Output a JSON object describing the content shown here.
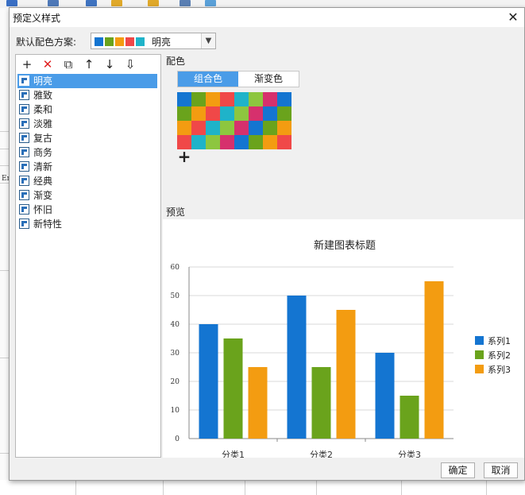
{
  "dialog": {
    "title": "预定义样式",
    "scheme_label": "默认配色方案:",
    "scheme_value": "明亮",
    "scheme_swatches": [
      "#1475d1",
      "#6aa31c",
      "#f39c11",
      "#f04848",
      "#1fb3c9"
    ],
    "ok_label": "确定",
    "cancel_label": "取消"
  },
  "toolbar": {
    "icons": [
      "add-icon",
      "delete-icon",
      "copy-icon",
      "move-up-icon",
      "move-down-icon",
      "move-to-bottom-icon"
    ],
    "glyphs": [
      "+",
      "✕",
      "⧉",
      "↑",
      "↓",
      "⇩"
    ]
  },
  "styles": {
    "selected": "明亮",
    "items": [
      "明亮",
      "雅致",
      "柔和",
      "淡雅",
      "复古",
      "商务",
      "清新",
      "经典",
      "渐变",
      "怀旧",
      "新特性"
    ]
  },
  "color_panel": {
    "label": "配色",
    "tabs": [
      "组合色",
      "渐变色"
    ],
    "active_tab": "组合色",
    "add_symbol": "+",
    "palette_rows": [
      [
        "#1475d1",
        "#6aa31c",
        "#f39c11",
        "#f04848",
        "#1fb3c9",
        "#8dc63f",
        "#d6306d",
        "#1475d1"
      ],
      [
        "#6aa31c",
        "#f39c11",
        "#f04848",
        "#1fb3c9",
        "#8dc63f",
        "#d6306d",
        "#1475d1",
        "#6aa31c"
      ],
      [
        "#f39c11",
        "#f04848",
        "#1fb3c9",
        "#8dc63f",
        "#d6306d",
        "#1475d1",
        "#6aa31c",
        "#f39c11"
      ],
      [
        "#f04848",
        "#1fb3c9",
        "#8dc63f",
        "#d6306d",
        "#1475d1",
        "#6aa31c",
        "#f39c11",
        "#f04848"
      ]
    ]
  },
  "preview": {
    "label": "预览"
  },
  "background": {
    "cell_text": "En"
  },
  "chart_data": {
    "type": "bar",
    "title": "新建图表标题",
    "categories": [
      "分类1",
      "分类2",
      "分类3"
    ],
    "series": [
      {
        "name": "系列1",
        "color": "#1475d1",
        "values": [
          40,
          50,
          30
        ]
      },
      {
        "name": "系列2",
        "color": "#6aa31c",
        "values": [
          35,
          25,
          15
        ]
      },
      {
        "name": "系列3",
        "color": "#f39c11",
        "values": [
          25,
          45,
          55
        ]
      }
    ],
    "ylim": [
      0,
      60
    ],
    "yticks": [
      0,
      10,
      20,
      30,
      40,
      50,
      60
    ],
    "grid": true,
    "legend": "right"
  }
}
